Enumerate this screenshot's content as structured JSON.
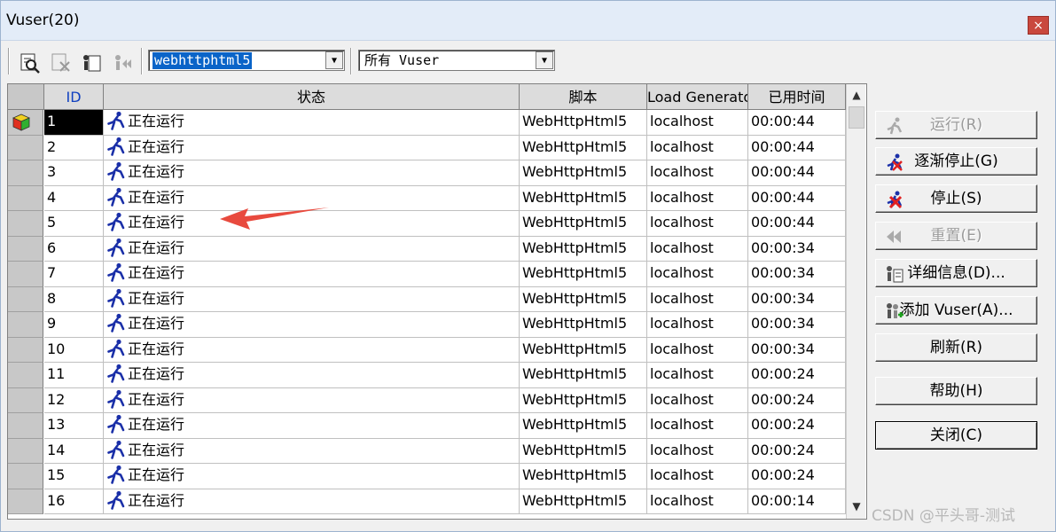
{
  "window": {
    "title": "Vuser(20)",
    "close_label": "×"
  },
  "toolbar": {
    "icons": [
      "details-icon",
      "remove-icon",
      "info-icon",
      "reset-icon"
    ],
    "script_filter": {
      "value": "webhttphtml5"
    },
    "status_filter": {
      "value": "所有 Vuser"
    }
  },
  "table": {
    "columns": [
      "ID",
      "状态",
      "脚本",
      "Load Generator",
      "已用时间"
    ],
    "rows": [
      {
        "id": "1",
        "status": "正在运行",
        "script": "WebHttpHtml5",
        "lg": "localhost",
        "elapsed": "00:00:44"
      },
      {
        "id": "2",
        "status": "正在运行",
        "script": "WebHttpHtml5",
        "lg": "localhost",
        "elapsed": "00:00:44"
      },
      {
        "id": "3",
        "status": "正在运行",
        "script": "WebHttpHtml5",
        "lg": "localhost",
        "elapsed": "00:00:44"
      },
      {
        "id": "4",
        "status": "正在运行",
        "script": "WebHttpHtml5",
        "lg": "localhost",
        "elapsed": "00:00:44"
      },
      {
        "id": "5",
        "status": "正在运行",
        "script": "WebHttpHtml5",
        "lg": "localhost",
        "elapsed": "00:00:44"
      },
      {
        "id": "6",
        "status": "正在运行",
        "script": "WebHttpHtml5",
        "lg": "localhost",
        "elapsed": "00:00:34"
      },
      {
        "id": "7",
        "status": "正在运行",
        "script": "WebHttpHtml5",
        "lg": "localhost",
        "elapsed": "00:00:34"
      },
      {
        "id": "8",
        "status": "正在运行",
        "script": "WebHttpHtml5",
        "lg": "localhost",
        "elapsed": "00:00:34"
      },
      {
        "id": "9",
        "status": "正在运行",
        "script": "WebHttpHtml5",
        "lg": "localhost",
        "elapsed": "00:00:34"
      },
      {
        "id": "10",
        "status": "正在运行",
        "script": "WebHttpHtml5",
        "lg": "localhost",
        "elapsed": "00:00:34"
      },
      {
        "id": "11",
        "status": "正在运行",
        "script": "WebHttpHtml5",
        "lg": "localhost",
        "elapsed": "00:00:24"
      },
      {
        "id": "12",
        "status": "正在运行",
        "script": "WebHttpHtml5",
        "lg": "localhost",
        "elapsed": "00:00:24"
      },
      {
        "id": "13",
        "status": "正在运行",
        "script": "WebHttpHtml5",
        "lg": "localhost",
        "elapsed": "00:00:24"
      },
      {
        "id": "14",
        "status": "正在运行",
        "script": "WebHttpHtml5",
        "lg": "localhost",
        "elapsed": "00:00:24"
      },
      {
        "id": "15",
        "status": "正在运行",
        "script": "WebHttpHtml5",
        "lg": "localhost",
        "elapsed": "00:00:24"
      },
      {
        "id": "16",
        "status": "正在运行",
        "script": "WebHttpHtml5",
        "lg": "localhost",
        "elapsed": "00:00:14"
      }
    ]
  },
  "buttons": {
    "run": "运行(R)",
    "gradual_stop": "逐渐停止(G)",
    "stop": "停止(S)",
    "reset": "重置(E)",
    "details": "详细信息(D)...",
    "add_vuser": "添加 Vuser(A)...",
    "refresh": "刷新(R)",
    "help": "帮助(H)",
    "close": "关闭(C)"
  },
  "colors": {
    "selection": "#0a64c8",
    "runner": "#1a2fa8",
    "stop_x": "#e02020",
    "annotation_arrow": "#e84a3e"
  },
  "watermark": "CSDN @平头哥-测试"
}
